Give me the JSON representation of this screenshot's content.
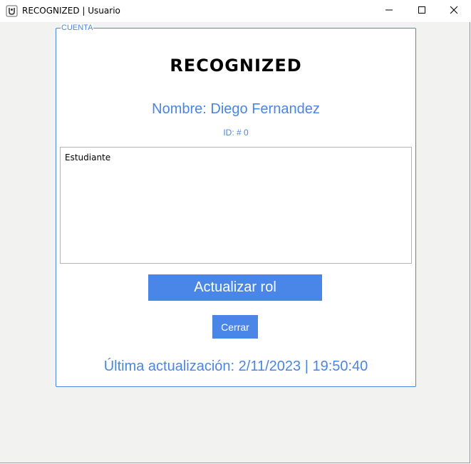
{
  "window": {
    "title": "RECOGNIZED | Usuario",
    "app_icon": "app-logo-icon",
    "controls": [
      "minimize-icon",
      "maximize-icon",
      "close-icon"
    ]
  },
  "panel": {
    "legend": "CUENTA",
    "app_title": "RECOGNIZED",
    "user_name": "Nombre: Diego Fernandez",
    "user_id": "ID: # 0",
    "role_text": "Estudiante",
    "update_button": "Actualizar rol",
    "close_button": "Cerrar",
    "last_update": "Última actualización: 2/11/2023 | 19:50:40"
  },
  "colors": {
    "accent": "#4a86e8",
    "panel_border": "#4a86e0",
    "window_bg": "#f2f2f1"
  }
}
